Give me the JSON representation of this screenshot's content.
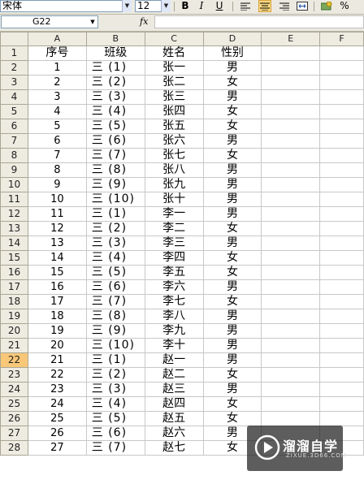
{
  "toolbar": {
    "font_name": "宋体",
    "font_size": "12",
    "bold": "B",
    "italic": "I",
    "underline": "U",
    "percent": "%"
  },
  "formula_bar": {
    "name_box": "G22",
    "fx": "fx",
    "formula": ""
  },
  "columns": [
    "A",
    "B",
    "C",
    "D",
    "E",
    "F"
  ],
  "selected_row": 22,
  "rows": [
    {
      "n": "1",
      "a": "序号",
      "b": "班级",
      "c": "姓名",
      "d": "性别"
    },
    {
      "n": "2",
      "a": "1",
      "b": "三 (1)",
      "c": "张一",
      "d": "男"
    },
    {
      "n": "3",
      "a": "2",
      "b": "三 (2)",
      "c": "张二",
      "d": "女"
    },
    {
      "n": "4",
      "a": "3",
      "b": "三 (3)",
      "c": "张三",
      "d": "男"
    },
    {
      "n": "5",
      "a": "4",
      "b": "三 (4)",
      "c": "张四",
      "d": "女"
    },
    {
      "n": "6",
      "a": "5",
      "b": "三 (5)",
      "c": "张五",
      "d": "女"
    },
    {
      "n": "7",
      "a": "6",
      "b": "三 (6)",
      "c": "张六",
      "d": "男"
    },
    {
      "n": "8",
      "a": "7",
      "b": "三 (7)",
      "c": "张七",
      "d": "女"
    },
    {
      "n": "9",
      "a": "8",
      "b": "三 (8)",
      "c": "张八",
      "d": "男"
    },
    {
      "n": "10",
      "a": "9",
      "b": "三 (9)",
      "c": "张九",
      "d": "男"
    },
    {
      "n": "11",
      "a": "10",
      "b": "三 (10)",
      "c": "张十",
      "d": "男"
    },
    {
      "n": "12",
      "a": "11",
      "b": "三 (1)",
      "c": "李一",
      "d": "男"
    },
    {
      "n": "13",
      "a": "12",
      "b": "三 (2)",
      "c": "李二",
      "d": "女"
    },
    {
      "n": "14",
      "a": "13",
      "b": "三 (3)",
      "c": "李三",
      "d": "男"
    },
    {
      "n": "15",
      "a": "14",
      "b": "三 (4)",
      "c": "李四",
      "d": "女"
    },
    {
      "n": "16",
      "a": "15",
      "b": "三 (5)",
      "c": "李五",
      "d": "女"
    },
    {
      "n": "17",
      "a": "16",
      "b": "三 (6)",
      "c": "李六",
      "d": "男"
    },
    {
      "n": "18",
      "a": "17",
      "b": "三 (7)",
      "c": "李七",
      "d": "女"
    },
    {
      "n": "19",
      "a": "18",
      "b": "三 (8)",
      "c": "李八",
      "d": "男"
    },
    {
      "n": "20",
      "a": "19",
      "b": "三 (9)",
      "c": "李九",
      "d": "男"
    },
    {
      "n": "21",
      "a": "20",
      "b": "三 (10)",
      "c": "李十",
      "d": "男"
    },
    {
      "n": "22",
      "a": "21",
      "b": "三 (1)",
      "c": "赵一",
      "d": "男"
    },
    {
      "n": "23",
      "a": "22",
      "b": "三 (2)",
      "c": "赵二",
      "d": "女"
    },
    {
      "n": "24",
      "a": "23",
      "b": "三 (3)",
      "c": "赵三",
      "d": "男"
    },
    {
      "n": "25",
      "a": "24",
      "b": "三 (4)",
      "c": "赵四",
      "d": "女"
    },
    {
      "n": "26",
      "a": "25",
      "b": "三 (5)",
      "c": "赵五",
      "d": "女"
    },
    {
      "n": "27",
      "a": "26",
      "b": "三 (6)",
      "c": "赵六",
      "d": "男"
    },
    {
      "n": "28",
      "a": "27",
      "b": "三 (7)",
      "c": "赵七",
      "d": "女"
    }
  ],
  "watermark": {
    "title": "溜溜自学",
    "url": "ZIXUE.3D66.COM"
  },
  "colors": {
    "header_bg": "#eeece1",
    "selected_header": "#f8c878",
    "grid_line": "#c8c8c8",
    "watermark_bg": "#1e1e1e"
  }
}
